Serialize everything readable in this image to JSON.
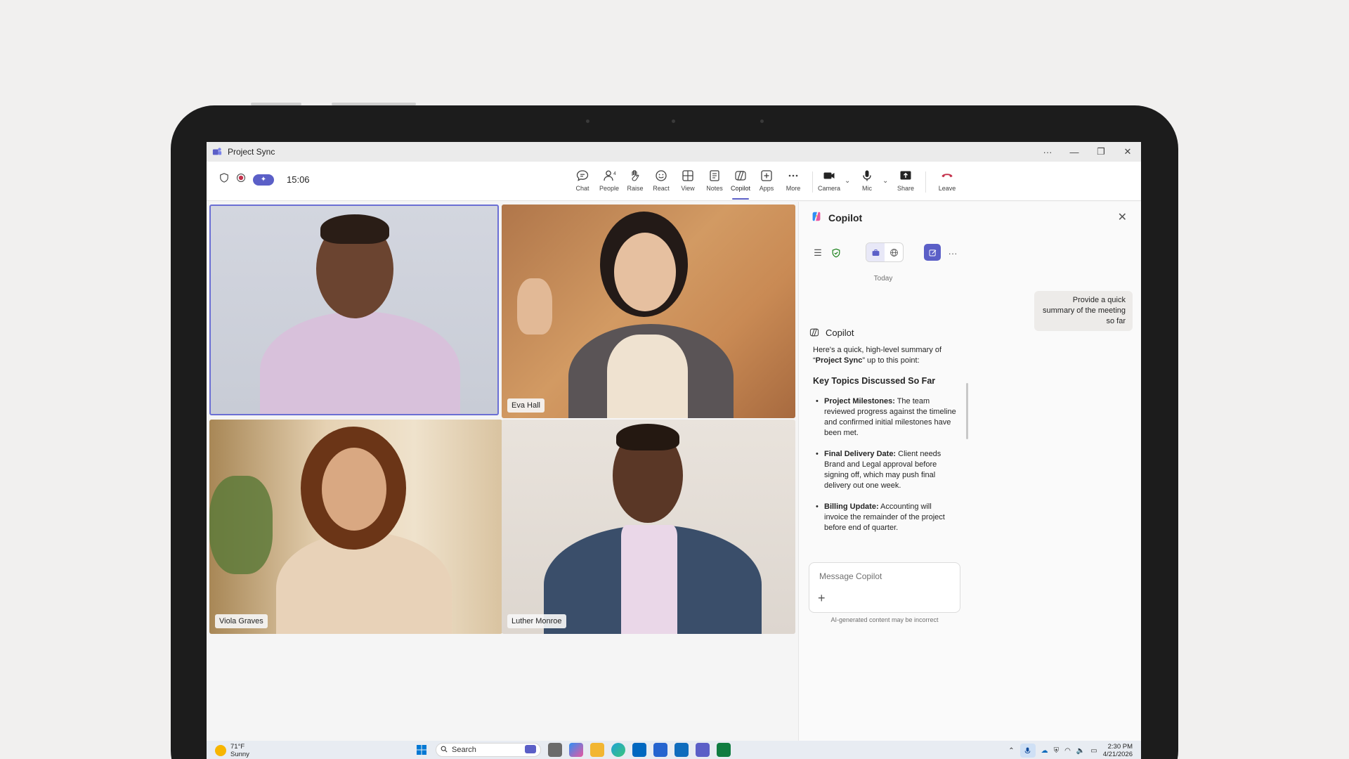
{
  "window": {
    "title": "Project Sync"
  },
  "meeting": {
    "timer": "15:06",
    "toolbar": [
      {
        "key": "chat",
        "label": "Chat"
      },
      {
        "key": "people",
        "label": "People",
        "count": "4"
      },
      {
        "key": "raise",
        "label": "Raise"
      },
      {
        "key": "react",
        "label": "React"
      },
      {
        "key": "view",
        "label": "View"
      },
      {
        "key": "notes",
        "label": "Notes"
      },
      {
        "key": "copilot",
        "label": "Copilot"
      },
      {
        "key": "apps",
        "label": "Apps"
      },
      {
        "key": "more",
        "label": "More"
      },
      {
        "key": "camera",
        "label": "Camera"
      },
      {
        "key": "mic",
        "label": "Mic"
      },
      {
        "key": "share",
        "label": "Share"
      },
      {
        "key": "leave",
        "label": "Leave"
      }
    ],
    "participants": [
      {
        "name": ""
      },
      {
        "name": "Eva Hall"
      },
      {
        "name": "Viola Graves"
      },
      {
        "name": "Luther Monroe"
      }
    ]
  },
  "copilot": {
    "title": "Copilot",
    "date_divider": "Today",
    "user_message": "Provide a quick summary of the meeting so far",
    "response_author": "Copilot",
    "response_intro_pre": "Here's a quick, high-level summary of “",
    "response_intro_bold": "Project Sync",
    "response_intro_post": "” up to this point:",
    "section_heading": "Key Topics Discussed So Far",
    "bullets": [
      {
        "term": "Project Milestones:",
        "text": " The team reviewed progress against the timeline and confirmed initial milestones have been met."
      },
      {
        "term": "Final Delivery Date:",
        "text": " Client needs Brand and Legal approval before signing off, which may push final delivery out one week."
      },
      {
        "term": "Billing Update:",
        "text": " Accounting will invoice the remainder of the project before end of quarter."
      }
    ],
    "input_placeholder": "Message Copilot",
    "disclaimer": "AI-generated content may be incorrect"
  },
  "taskbar": {
    "weather_temp": "71°F",
    "weather_desc": "Sunny",
    "search_label": "Search",
    "time": "2:30 PM",
    "date": "4/21/2026"
  },
  "colors": {
    "accent": "#5b5fc7",
    "leave": "#c4314b"
  }
}
